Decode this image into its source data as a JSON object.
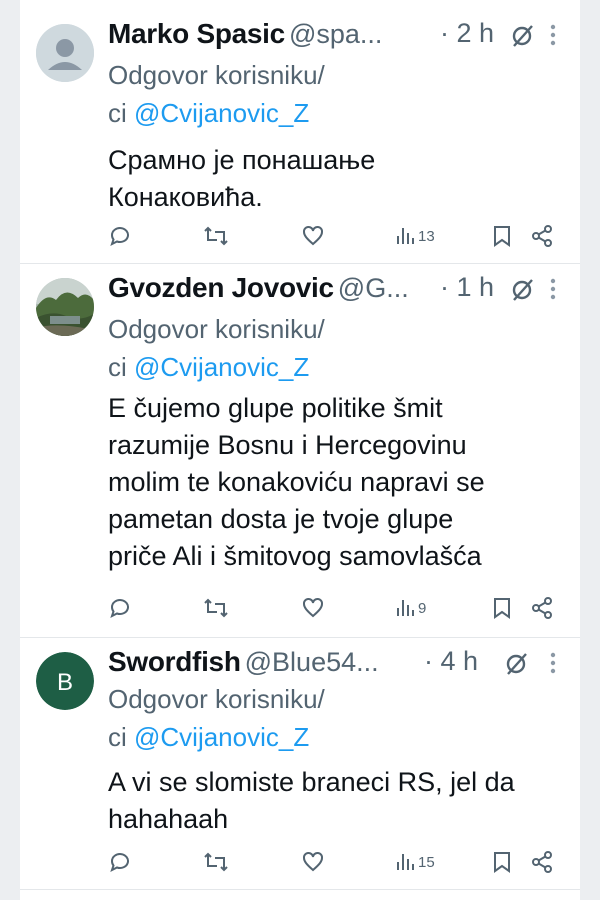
{
  "tweets": [
    {
      "display_name": "Marko Spasic",
      "handle": "@spa...",
      "time": "· 2 h",
      "reply_prefix": "Odgovor korisniku/",
      "reply_prefix2": "ci ",
      "mention": "@Cvijanovic_Z",
      "body": [
        "Срамно је понашање",
        "Конаковића."
      ],
      "views": "13",
      "avatar": "default-avatar-icon"
    },
    {
      "display_name": "Gvozden Jovovic",
      "handle": "@G...",
      "time": "· 1 h",
      "reply_prefix": "Odgovor korisniku/",
      "reply_prefix2": "ci ",
      "mention": "@Cvijanovic_Z",
      "body": [
        "E čujemo glupe politike šmit",
        "razumije Bosnu i Hercegovinu",
        "molim te konakoviću napravi se",
        "pametan dosta je tvoje glupe",
        "priče Ali i šmitovog samovlašća"
      ],
      "views": "9",
      "avatar": "landscape-photo-avatar"
    },
    {
      "display_name": "Swordfish",
      "handle": "@Blue54...",
      "time": "· 4 h",
      "reply_prefix": "Odgovor korisniku/",
      "reply_prefix2": "ci ",
      "mention": "@Cvijanovic_Z",
      "body": [
        "A vi se slomiste braneci RS, jel da",
        "hahahaah"
      ],
      "views": "15",
      "avatar_letter": "B",
      "avatar_color": "#1e5e45"
    }
  ],
  "colors": {
    "link": "#1d9bf0",
    "secondary_text": "#536471",
    "primary_text": "#0f1419"
  }
}
